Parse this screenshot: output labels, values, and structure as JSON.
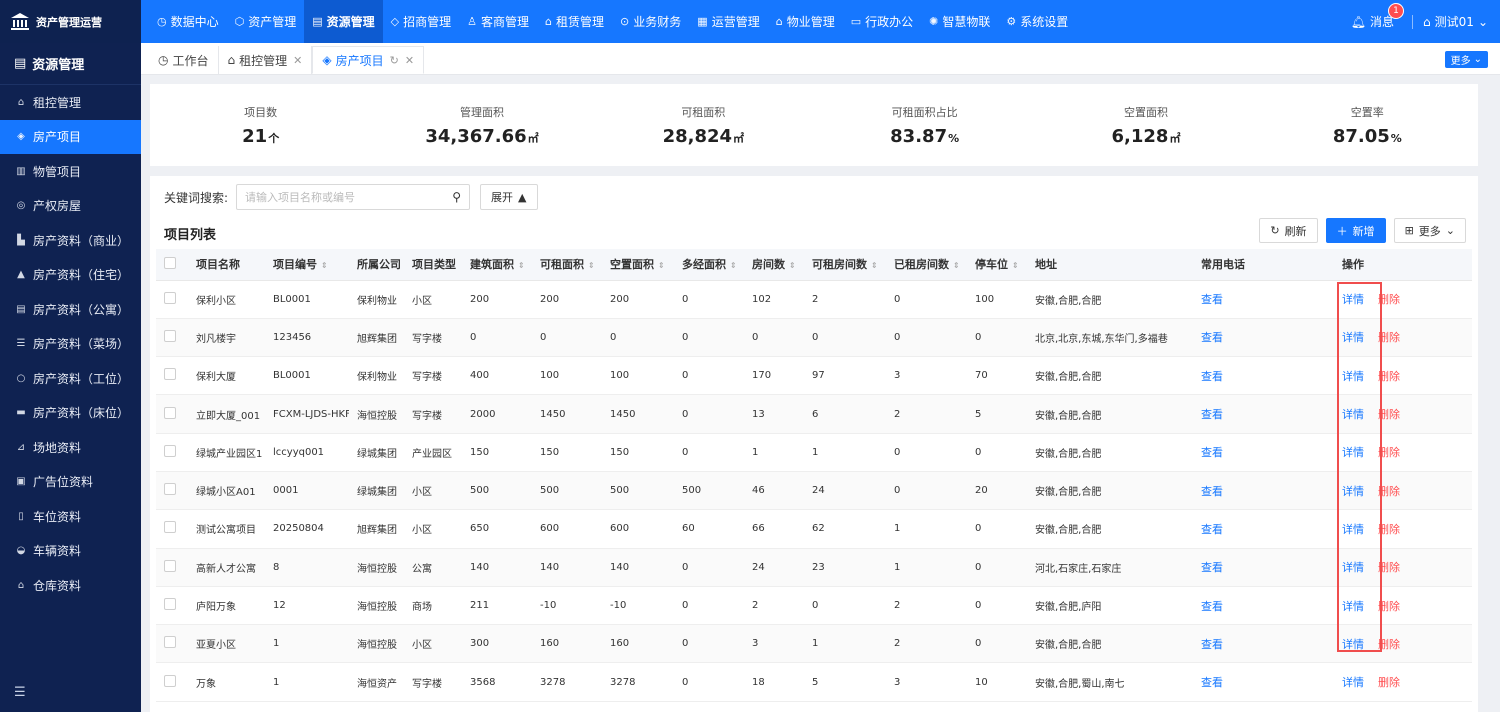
{
  "app": {
    "brand_name": "资产管理运营"
  },
  "topnav": [
    {
      "label": "数据中心",
      "icon": "dashboard-icon"
    },
    {
      "label": "资产管理",
      "icon": "cube-icon"
    },
    {
      "label": "资源管理",
      "icon": "document-icon",
      "active": true
    },
    {
      "label": "招商管理",
      "icon": "tag-icon"
    },
    {
      "label": "客商管理",
      "icon": "users-icon"
    },
    {
      "label": "租赁管理",
      "icon": "building-icon"
    },
    {
      "label": "业务财务",
      "icon": "money-icon"
    },
    {
      "label": "运营管理",
      "icon": "chart-icon"
    },
    {
      "label": "物业管理",
      "icon": "home-icon"
    },
    {
      "label": "行政办公",
      "icon": "monitor-icon"
    },
    {
      "label": "智慧物联",
      "icon": "iot-icon"
    },
    {
      "label": "系统设置",
      "icon": "gear-icon"
    }
  ],
  "topright": {
    "messages_label": "消息",
    "messages_badge": "1",
    "user_name": "测试01"
  },
  "sidebar": {
    "title": "资源管理",
    "items": [
      {
        "label": "租控管理",
        "icon": "home-icon"
      },
      {
        "label": "房产项目",
        "icon": "layers-icon",
        "active": true
      },
      {
        "label": "物管项目",
        "icon": "building-icon"
      },
      {
        "label": "产权房屋",
        "icon": "house-icon"
      },
      {
        "label": "房产资料（商业）",
        "icon": "shop-icon"
      },
      {
        "label": "房产资料（住宅）",
        "icon": "residence-icon"
      },
      {
        "label": "房产资料（公寓）",
        "icon": "apartment-icon"
      },
      {
        "label": "房产资料（菜场）",
        "icon": "market-icon"
      },
      {
        "label": "房产资料（工位）",
        "icon": "desk-icon"
      },
      {
        "label": "房产资料（床位）",
        "icon": "bed-icon"
      },
      {
        "label": "场地资料",
        "icon": "venue-icon"
      },
      {
        "label": "广告位资料",
        "icon": "ad-icon"
      },
      {
        "label": "车位资料",
        "icon": "parking-icon"
      },
      {
        "label": "车辆资料",
        "icon": "car-icon"
      },
      {
        "label": "仓库资料",
        "icon": "warehouse-icon"
      }
    ]
  },
  "tabs": [
    {
      "label": "工作台",
      "icon": "dashboard-icon"
    },
    {
      "label": "租控管理",
      "icon": "home-icon",
      "closable": true
    },
    {
      "label": "房产项目",
      "icon": "layers-icon",
      "active": true,
      "closable": true
    }
  ],
  "tabs_more_label": "更多",
  "stats": [
    {
      "label": "项目数",
      "value": "21",
      "unit": "个"
    },
    {
      "label": "管理面积",
      "value": "34,367.66",
      "unit": "㎡"
    },
    {
      "label": "可租面积",
      "value": "28,824",
      "unit": "㎡"
    },
    {
      "label": "可租面积占比",
      "value": "83.87",
      "unit": "%"
    },
    {
      "label": "空置面积",
      "value": "6,128",
      "unit": "㎡"
    },
    {
      "label": "空置率",
      "value": "87.05",
      "unit": "%"
    }
  ],
  "search": {
    "label": "关键词搜索:",
    "placeholder": "请输入项目名称或编号",
    "expand_label": "展开"
  },
  "list": {
    "title": "项目列表",
    "refresh_label": "刷新",
    "add_label": "新增",
    "more_label": "更多",
    "view_label": "查看",
    "detail_label": "详情",
    "delete_label": "删除"
  },
  "table": {
    "headers": [
      "项目名称",
      "项目编号",
      "所属公司",
      "项目类型",
      "建筑面积",
      "可租面积",
      "空置面积",
      "多经面积",
      "房间数",
      "可租房间数",
      "已租房间数",
      "停车位",
      "地址",
      "常用电话",
      "操作"
    ],
    "rows": [
      [
        "保利小区",
        "BL0001",
        "保利物业",
        "小区",
        "200",
        "200",
        "200",
        "0",
        "102",
        "2",
        "0",
        "100",
        "安徽,合肥,合肥"
      ],
      [
        "刘凡楼宇",
        "123456",
        "旭辉集团",
        "写字楼",
        "0",
        "0",
        "0",
        "0",
        "0",
        "0",
        "0",
        "0",
        "北京,北京,东城,东华门,多福巷"
      ],
      [
        "保利大厦",
        "BL0001",
        "保利物业",
        "写字楼",
        "400",
        "100",
        "100",
        "0",
        "170",
        "97",
        "3",
        "70",
        "安徽,合肥,合肥"
      ],
      [
        "立即大厦_001",
        "FCXM-LJDS-HKF",
        "海恒控股",
        "写字楼",
        "2000",
        "1450",
        "1450",
        "0",
        "13",
        "6",
        "2",
        "5",
        "安徽,合肥,合肥"
      ],
      [
        "绿城产业园区1",
        "lccyyq001",
        "绿城集团",
        "产业园区",
        "150",
        "150",
        "150",
        "0",
        "1",
        "1",
        "0",
        "0",
        "安徽,合肥,合肥"
      ],
      [
        "绿城小区A01",
        "0001",
        "绿城集团",
        "小区",
        "500",
        "500",
        "500",
        "500",
        "46",
        "24",
        "0",
        "20",
        "安徽,合肥,合肥"
      ],
      [
        "测试公寓项目",
        "20250804",
        "旭辉集团",
        "小区",
        "650",
        "600",
        "600",
        "60",
        "66",
        "62",
        "1",
        "0",
        "安徽,合肥,合肥"
      ],
      [
        "高新人才公寓",
        "8",
        "海恒控股",
        "公寓",
        "140",
        "140",
        "140",
        "0",
        "24",
        "23",
        "1",
        "0",
        "河北,石家庄,石家庄"
      ],
      [
        "庐阳万象",
        "12",
        "海恒控股",
        "商场",
        "211",
        "-10",
        "-10",
        "0",
        "2",
        "0",
        "2",
        "0",
        "安徽,合肥,庐阳"
      ],
      [
        "亚夏小区",
        "1",
        "海恒控股",
        "小区",
        "300",
        "160",
        "160",
        "0",
        "3",
        "1",
        "2",
        "0",
        "安徽,合肥,合肥"
      ],
      [
        "万象",
        "1",
        "海恒资产",
        "写字楼",
        "3568",
        "3278",
        "3278",
        "0",
        "18",
        "5",
        "3",
        "10",
        "安徽,合肥,蜀山,南七"
      ]
    ]
  },
  "colors": {
    "primary": "#1677ff",
    "sidebar": "#0f2251",
    "danger": "#ff4d4f",
    "highlight": "#f04d4d"
  }
}
